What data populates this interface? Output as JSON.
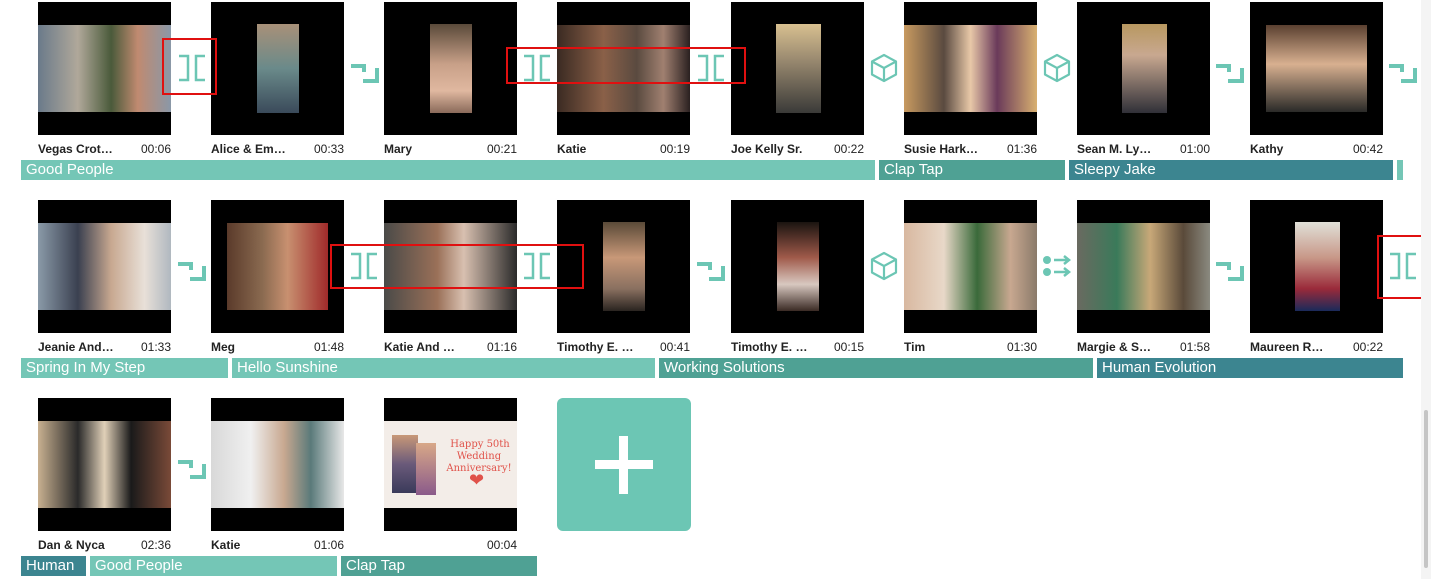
{
  "clips": [
    {
      "name": "Vegas Crot…",
      "duration": "00:06"
    },
    {
      "name": "Alice & Em…",
      "duration": "00:33"
    },
    {
      "name": "Mary",
      "duration": "00:21"
    },
    {
      "name": "Katie",
      "duration": "00:19"
    },
    {
      "name": "Joe Kelly Sr.",
      "duration": "00:22"
    },
    {
      "name": "Susie Hark…",
      "duration": "01:36"
    },
    {
      "name": "Sean M. Ly…",
      "duration": "01:00"
    },
    {
      "name": "Kathy",
      "duration": "00:42"
    },
    {
      "name": "Jeanie And…",
      "duration": "01:33"
    },
    {
      "name": "Meg",
      "duration": "01:48"
    },
    {
      "name": "Katie And …",
      "duration": "01:16"
    },
    {
      "name": "Timothy E. …",
      "duration": "00:41"
    },
    {
      "name": "Timothy E. …",
      "duration": "00:15"
    },
    {
      "name": "Tim",
      "duration": "01:30"
    },
    {
      "name": "Margie & S…",
      "duration": "01:58"
    },
    {
      "name": "Maureen R…",
      "duration": "00:22"
    },
    {
      "name": "Dan & Nyca",
      "duration": "02:36"
    },
    {
      "name": "Katie",
      "duration": "01:06"
    },
    {
      "name": "",
      "duration": "00:04",
      "card_text": [
        "Happy 50th",
        "Wedding Anniversary!"
      ]
    }
  ],
  "music_tracks": [
    {
      "title": "Good People"
    },
    {
      "title": "Clap Tap"
    },
    {
      "title": "Sleepy Jake"
    },
    {
      "title": "Spring In My Step"
    },
    {
      "title": "Hello Sunshine"
    },
    {
      "title": "Working Solutions"
    },
    {
      "title": "Human Evolution"
    },
    {
      "title": "Human"
    },
    {
      "title": "Good People"
    },
    {
      "title": "Clap Tap"
    }
  ],
  "transition_icons": [
    "bracket-transition-icon",
    "corner-transition-icon",
    "cube-transition-icon",
    "swap-transition-icon"
  ],
  "colors": {
    "accent": "#6cc6b4",
    "track_light": "#74c6b6",
    "track_mid": "#4fa194",
    "track_dark": "#3c8590",
    "highlight": "#e01010"
  }
}
